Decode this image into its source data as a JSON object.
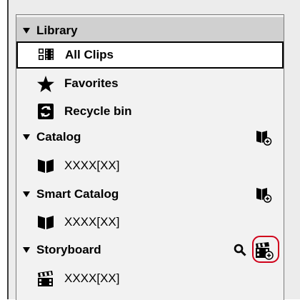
{
  "sidebar": {
    "library": {
      "label": "Library",
      "icon": "triangle-down-icon"
    },
    "all_clips": {
      "label": "All Clips",
      "icon": "clips-icon"
    },
    "favorites": {
      "label": "Favorites",
      "icon": "star-icon"
    },
    "recycle_bin": {
      "label": "Recycle bin",
      "icon": "recycle-bin-icon"
    },
    "catalog": {
      "label": "Catalog",
      "icon": "triangle-down-icon",
      "action_icon": "add-catalog-icon",
      "items": [
        {
          "label": "XXXX[XX]",
          "icon": "book-icon"
        }
      ]
    },
    "smart_catalog": {
      "label": "Smart Catalog",
      "icon": "triangle-down-icon",
      "action_icon": "add-smart-catalog-icon",
      "items": [
        {
          "label": "XXXX[XX]",
          "icon": "book-icon"
        }
      ]
    },
    "storyboard": {
      "label": "Storyboard",
      "icon": "triangle-down-icon",
      "search_icon": "search-icon",
      "action_icon": "add-storyboard-icon",
      "items": [
        {
          "label": "XXXX[XX]",
          "icon": "clapper-icon"
        }
      ]
    }
  },
  "colors": {
    "selection_outline": "#000000",
    "highlight": "#d0021b",
    "header_bg": "#d0d0d0"
  }
}
